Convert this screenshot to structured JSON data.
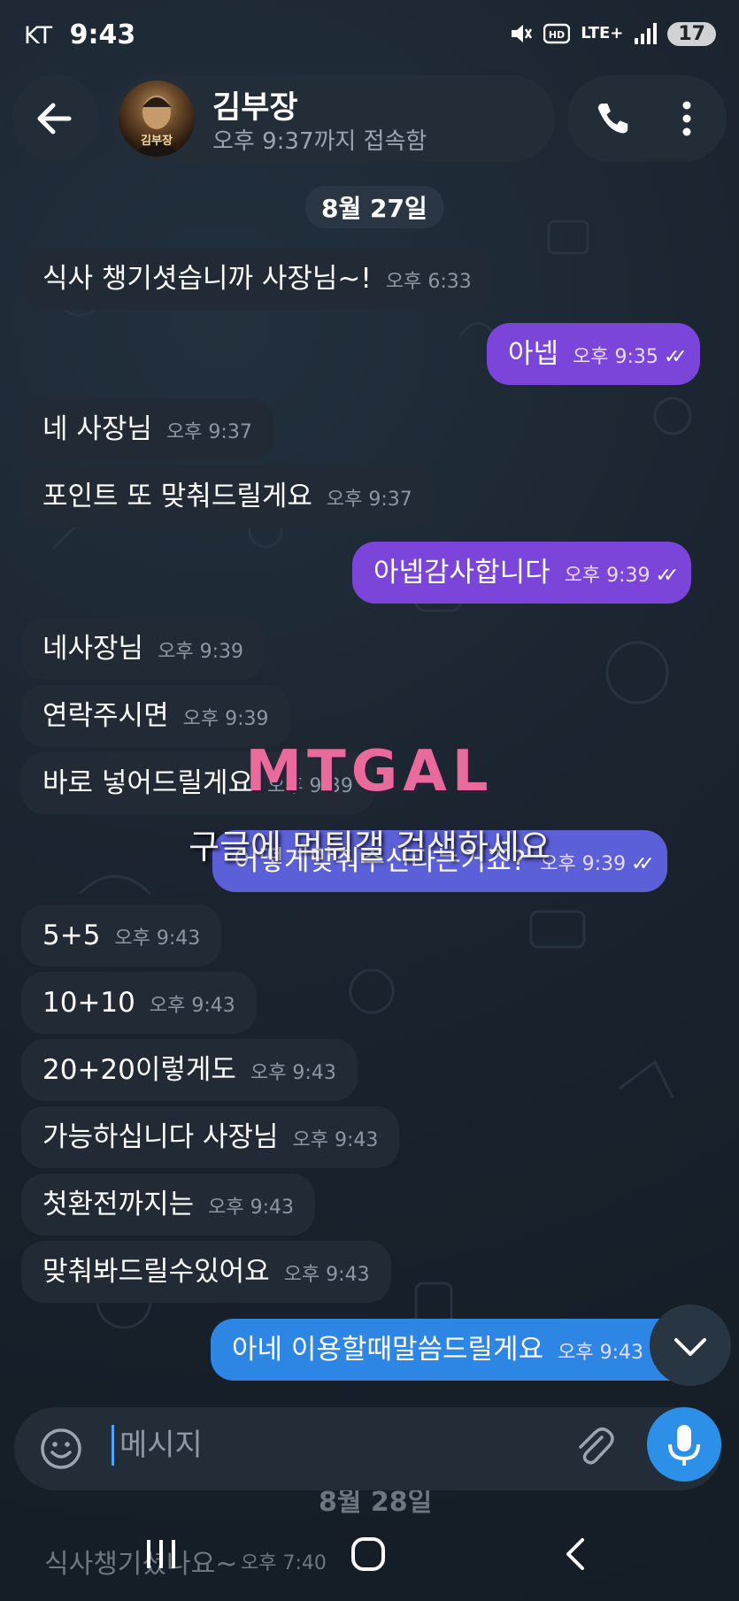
{
  "status_bar": {
    "carrier": "KT",
    "time": "9:43",
    "battery": "17",
    "network": "LTE+"
  },
  "header": {
    "contact_name": "김부장",
    "last_seen": "오후 9:37까지 접속함",
    "avatar_caption": "김부장"
  },
  "date_divider": "8월 27일",
  "messages": [
    {
      "dir": "in",
      "text": "식사 챙기셧습니까 사장님~!",
      "time": "오후 6:33"
    },
    {
      "dir": "out",
      "text": "아넵",
      "time": "오후 9:35"
    },
    {
      "dir": "in",
      "text": "네 사장님",
      "time": "오후 9:37"
    },
    {
      "dir": "in",
      "text": "포인트 또 맞춰드릴게요",
      "time": "오후 9:37"
    },
    {
      "dir": "out",
      "text": "아넵감사합니다",
      "time": "오후 9:39"
    },
    {
      "dir": "in",
      "text": "네사장님",
      "time": "오후 9:39"
    },
    {
      "dir": "in",
      "text": "연락주시면",
      "time": "오후 9:39"
    },
    {
      "dir": "in",
      "text": "바로 넣어드릴게요",
      "time": "오후 9:39"
    },
    {
      "dir": "out",
      "text": "어떻게맞춰주신다는거죠?",
      "time": "오후 9:39"
    },
    {
      "dir": "in",
      "text": "5+5",
      "time": "오후 9:43"
    },
    {
      "dir": "in",
      "text": "10+10",
      "time": "오후 9:43"
    },
    {
      "dir": "in",
      "text": "20+20이렇게도",
      "time": "오후 9:43"
    },
    {
      "dir": "in",
      "text": "가능하십니다 사장님",
      "time": "오후 9:43"
    },
    {
      "dir": "in",
      "text": "첫환전까지는",
      "time": "오후 9:43"
    },
    {
      "dir": "in",
      "text": "맞춰봐드릴수있어요",
      "time": "오후 9:43"
    },
    {
      "dir": "out-blue",
      "text": "아네 이용할때말씀드릴게요",
      "time": "오후 9:43"
    }
  ],
  "faded_below": {
    "date_divider": "8월 28일",
    "message_text": "식사챙기셨나요~",
    "message_time": "오후 7:40"
  },
  "watermark": {
    "logo": "MTGAL",
    "caption": "구글에 먹튀갤 검색하세요"
  },
  "input": {
    "placeholder": "메시지"
  },
  "colors": {
    "background": "#1a232e",
    "incoming_bubble": "#222b35",
    "outgoing_bubble": "#7a45d8",
    "outgoing_bubble_last": "#2d86e4",
    "accent": "#2d90e8"
  },
  "icons": [
    "back-arrow-icon",
    "phone-icon",
    "more-vertical-icon",
    "double-check-icon",
    "scroll-down-icon",
    "emoji-icon",
    "attach-icon",
    "mic-icon",
    "nav-recents-icon",
    "nav-home-icon",
    "nav-back-icon"
  ]
}
